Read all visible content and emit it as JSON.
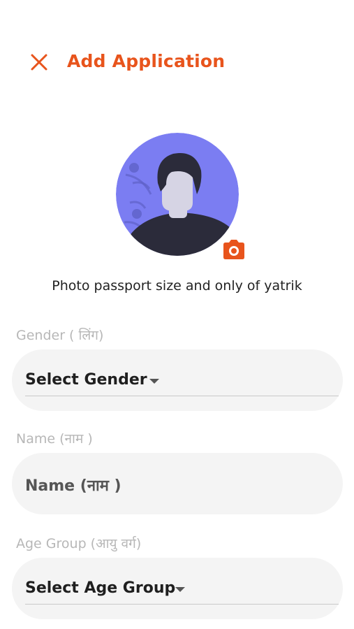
{
  "header": {
    "close_icon": "close-icon",
    "title": "Add Application"
  },
  "photo": {
    "avatar_icon": "person-avatar-illustration",
    "camera_icon": "camera-icon",
    "hint": "Photo passport size and only of yatrik"
  },
  "form": {
    "gender": {
      "label": "Gender ( लिंग)",
      "value": "Select Gender",
      "dropdown_icon": "caret-down-icon"
    },
    "name": {
      "label": "Name (नाम )",
      "placeholder": "Name (नाम )"
    },
    "age_group": {
      "label": "Age Group (आयु वर्ग)",
      "value": "Select Age Group",
      "dropdown_icon": "caret-down-icon"
    }
  },
  "colors": {
    "accent": "#e8541c",
    "avatar_bg": "#7b7df2",
    "field_bg": "#f4f4f4",
    "label": "#b7b7b7"
  }
}
